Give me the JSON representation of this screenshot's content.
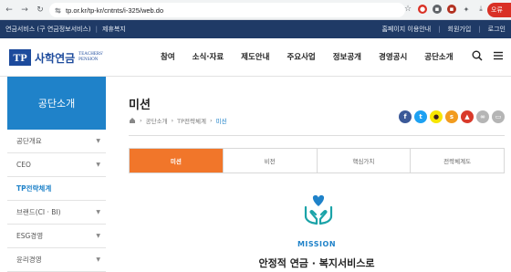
{
  "browser": {
    "url": "tp.or.kr/tp-kr/cntnts/i-325/web.do",
    "profile_label": "오류"
  },
  "utility": {
    "left_items": [
      "연금서비스 (구 연금정보서비스)",
      "|",
      "제휴복지"
    ],
    "right_items": [
      "홈페이지 이용안내",
      "|",
      "회원가입",
      "|",
      "로그인"
    ]
  },
  "header": {
    "logo_mark": "TP",
    "logo_name": "사학연금",
    "logo_en_1": "TEACHERS'",
    "logo_en_2": "PENSION",
    "menu": [
      "참여",
      "소식·자료",
      "제도안내",
      "주요사업",
      "정보공개",
      "경영공시",
      "공단소개"
    ]
  },
  "sidebar": {
    "title": "공단소개",
    "items": [
      {
        "label": "공단개요",
        "active": false
      },
      {
        "label": "CEO",
        "active": false
      },
      {
        "label": "TP전략체계",
        "active": true
      },
      {
        "label": "브랜드(CI · BI)",
        "active": false
      },
      {
        "label": "ESG경영",
        "active": false
      },
      {
        "label": "윤리경영",
        "active": false
      }
    ]
  },
  "content": {
    "title": "미션",
    "breadcrumb": [
      "공단소개",
      "TP전략체계",
      "미션"
    ],
    "tabs": [
      {
        "label": "미션",
        "active": true
      },
      {
        "label": "비전",
        "active": false
      },
      {
        "label": "핵심가치",
        "active": false
      },
      {
        "label": "전략체계도",
        "active": false
      }
    ],
    "mission_label": "MISSION",
    "mission_text": "안정적 연금 · 복지서비스로"
  },
  "colors": {
    "navy": "#1f3a66",
    "brand_blue": "#1c4a9c",
    "accent_blue": "#1f82c9",
    "active_tab": "#f1762a"
  },
  "share": [
    {
      "icon": "facebook-icon",
      "glyph": "f",
      "color": "#3b5998"
    },
    {
      "icon": "twitter-icon",
      "glyph": "t",
      "color": "#1da1f2"
    },
    {
      "icon": "kakaotalk-icon",
      "glyph": "k",
      "color": "#f7e600"
    },
    {
      "icon": "kakaostory-icon",
      "glyph": "s",
      "color": "#f29c1f"
    },
    {
      "icon": "pdf-icon",
      "glyph": "p",
      "color": "#d93a2b"
    },
    {
      "icon": "link-icon",
      "glyph": "∞",
      "color": "#b5b5b5"
    },
    {
      "icon": "print-icon",
      "glyph": "⎙",
      "color": "#b5b5b5"
    }
  ]
}
